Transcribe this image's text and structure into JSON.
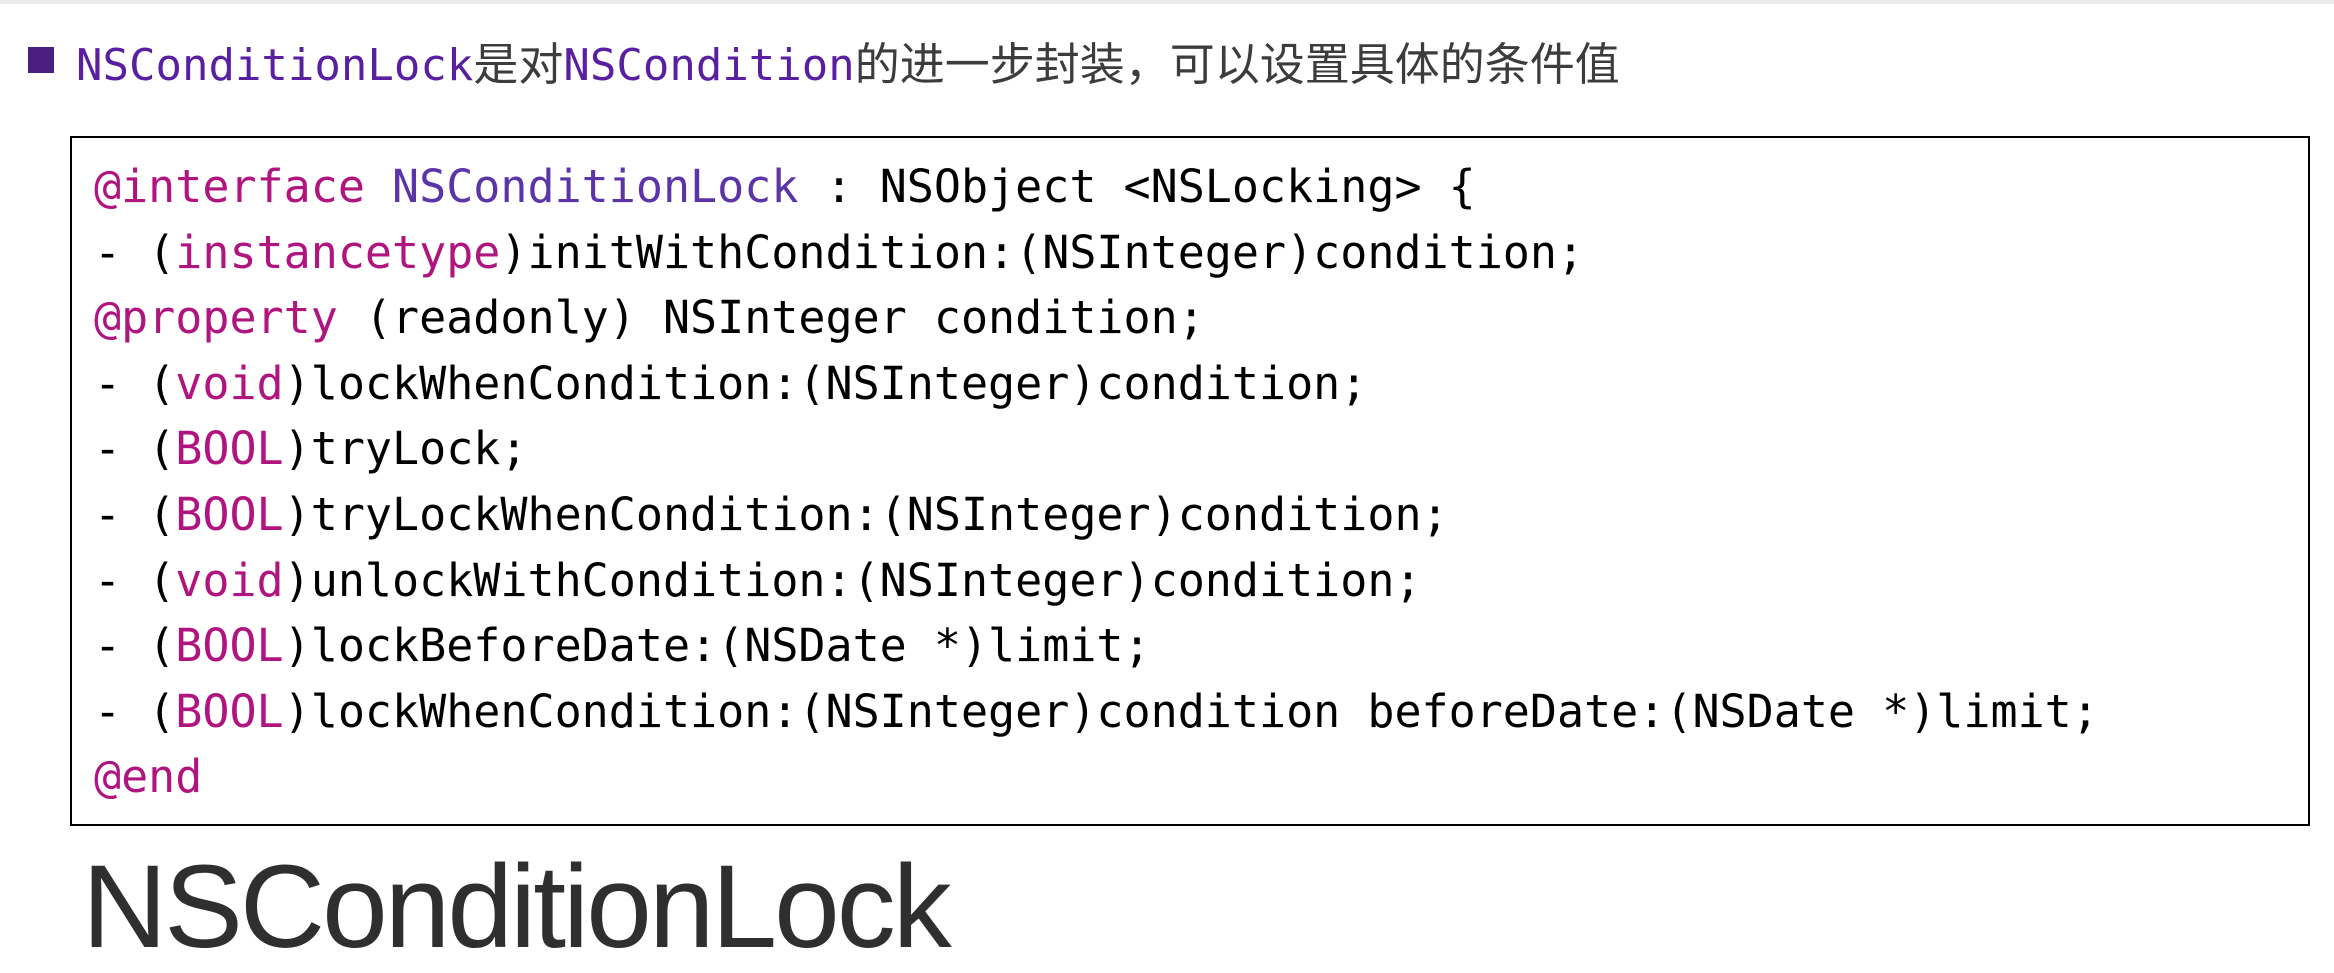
{
  "bullet": {
    "term1": "NSConditionLock",
    "text1": "是对",
    "term2": "NSCondition",
    "text2": "的进一步封装，可以设置具体的条件值",
    "color": "#4b1e83"
  },
  "code": {
    "lines": [
      {
        "parts": [
          {
            "t": "@interface",
            "k": "k"
          },
          {
            "t": " "
          },
          {
            "t": "NSConditionLock",
            "k": "c"
          },
          {
            "t": " : NSObject <NSLocking> {"
          }
        ]
      },
      {
        "parts": [
          {
            "t": "- ("
          },
          {
            "t": "instancetype",
            "k": "k"
          },
          {
            "t": ")initWithCondition:(NSInteger)condition;"
          }
        ]
      },
      {
        "parts": [
          {
            "t": "@property",
            "k": "k"
          },
          {
            "t": " (readonly) NSInteger condition;"
          }
        ]
      },
      {
        "parts": [
          {
            "t": "- ("
          },
          {
            "t": "void",
            "k": "k"
          },
          {
            "t": ")lockWhenCondition:(NSInteger)condition;"
          }
        ]
      },
      {
        "parts": [
          {
            "t": "- ("
          },
          {
            "t": "BOOL",
            "k": "k"
          },
          {
            "t": ")tryLock;"
          }
        ]
      },
      {
        "parts": [
          {
            "t": "- ("
          },
          {
            "t": "BOOL",
            "k": "k"
          },
          {
            "t": ")tryLockWhenCondition:(NSInteger)condition;"
          }
        ]
      },
      {
        "parts": [
          {
            "t": "- ("
          },
          {
            "t": "void",
            "k": "k"
          },
          {
            "t": ")unlockWithCondition:(NSInteger)condition;"
          }
        ]
      },
      {
        "parts": [
          {
            "t": "- ("
          },
          {
            "t": "BOOL",
            "k": "k"
          },
          {
            "t": ")lockBeforeDate:(NSDate *)limit;"
          }
        ]
      },
      {
        "parts": [
          {
            "t": "- ("
          },
          {
            "t": "BOOL",
            "k": "k"
          },
          {
            "t": ")lockWhenCondition:(NSInteger)condition beforeDate:(NSDate *)limit;"
          }
        ]
      },
      {
        "parts": [
          {
            "t": "@end",
            "k": "k"
          }
        ]
      }
    ],
    "keyword_color": "#b0147f",
    "class_color": "#5b35a8"
  },
  "title": "NSConditionLock"
}
